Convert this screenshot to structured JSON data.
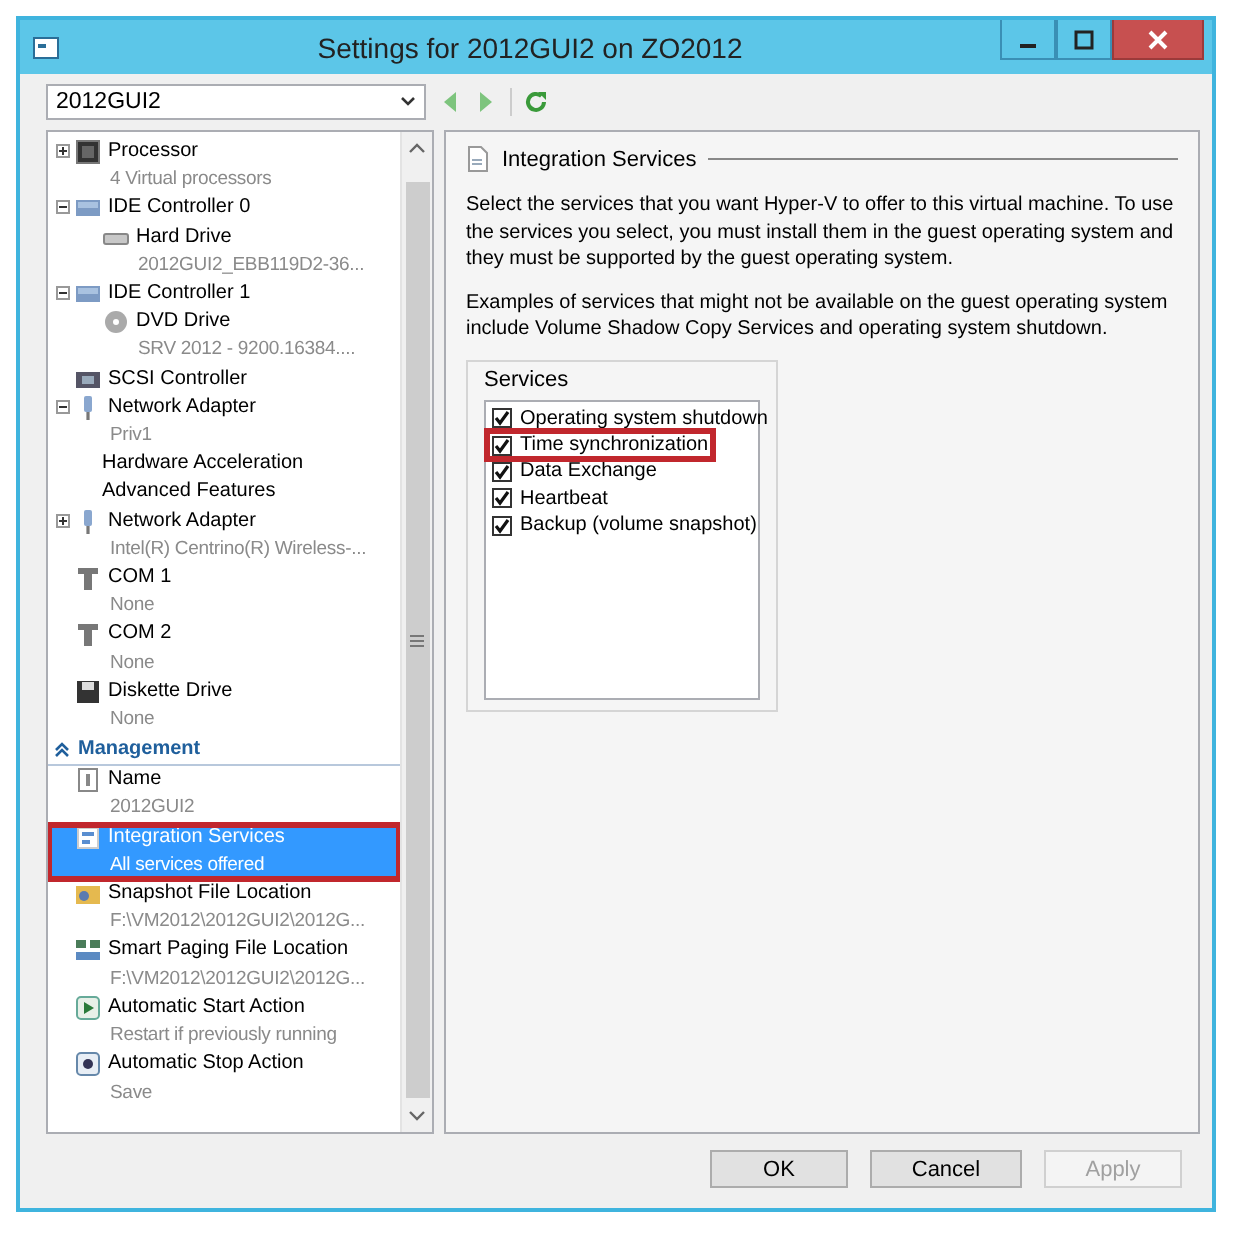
{
  "window": {
    "title": "Settings for 2012GUI2 on ZO2012"
  },
  "vm_selector": {
    "value": "2012GUI2"
  },
  "sidebar": {
    "sections": [
      {
        "items": [
          {
            "kind": "processor",
            "name": "Processor",
            "detail": "4 Virtual processors",
            "expanded": false,
            "selected": false,
            "highlighted": false
          },
          {
            "kind": "controller",
            "name": "IDE Controller 0",
            "expanded": true,
            "selected": false,
            "highlighted": false,
            "children": [
              {
                "kind": "disk",
                "name": "Hard Drive",
                "detail": "2012GUI2_EBB119D2-36...",
                "selected": false,
                "highlighted": false
              }
            ]
          },
          {
            "kind": "controller",
            "name": "IDE Controller 1",
            "expanded": true,
            "selected": false,
            "highlighted": false,
            "children": [
              {
                "kind": "dvd",
                "name": "DVD Drive",
                "detail": "SRV 2012 - 9200.16384....",
                "selected": false,
                "highlighted": false
              }
            ]
          },
          {
            "kind": "scsi",
            "name": "SCSI Controller",
            "selected": false,
            "highlighted": false
          },
          {
            "kind": "network",
            "name": "Network Adapter",
            "detail": "Priv1",
            "expanded": true,
            "selected": false,
            "highlighted": false,
            "children": [
              {
                "kind": "setting",
                "name": "Hardware Acceleration",
                "selected": false,
                "highlighted": false
              },
              {
                "kind": "setting",
                "name": "Advanced Features",
                "selected": false,
                "highlighted": false
              }
            ]
          },
          {
            "kind": "network",
            "name": "Network Adapter",
            "detail": "Intel(R) Centrino(R) Wireless-...",
            "expanded": false,
            "selected": false,
            "highlighted": false
          },
          {
            "kind": "com",
            "name": "COM 1",
            "detail": "None",
            "selected": false,
            "highlighted": false
          },
          {
            "kind": "com",
            "name": "COM 2",
            "detail": "None",
            "selected": false,
            "highlighted": false
          },
          {
            "kind": "floppy",
            "name": "Diskette Drive",
            "detail": "None",
            "selected": false,
            "highlighted": false
          }
        ]
      },
      {
        "title": "Management",
        "expanded": true,
        "items": [
          {
            "kind": "name",
            "name": "Name",
            "detail": "2012GUI2",
            "selected": false,
            "highlighted": false
          },
          {
            "kind": "integration",
            "name": "Integration Services",
            "detail": "All services offered",
            "selected": true,
            "highlighted": true
          },
          {
            "kind": "snapshot",
            "name": "Snapshot File Location",
            "detail": "F:\\VM2012\\2012GUI2\\2012G...",
            "selected": false,
            "highlighted": false
          },
          {
            "kind": "paging",
            "name": "Smart Paging File Location",
            "detail": "F:\\VM2012\\2012GUI2\\2012G...",
            "selected": false,
            "highlighted": false
          },
          {
            "kind": "start",
            "name": "Automatic Start Action",
            "detail": "Restart if previously running",
            "selected": false,
            "highlighted": false
          },
          {
            "kind": "stop",
            "name": "Automatic Stop Action",
            "detail": "Save",
            "selected": false,
            "highlighted": false
          }
        ]
      }
    ]
  },
  "panel": {
    "title": "Integration Services",
    "paragraphs": [
      "Select the services that you want Hyper-V to offer to this virtual machine. To use the services you select, you must install them in the guest operating system and they must be supported by the guest operating system.",
      "Examples of services that might not be available on the guest operating system include Volume Shadow Copy Services and operating system shutdown."
    ],
    "services": {
      "label": "Services",
      "items": [
        {
          "label": "Operating system shutdown",
          "checked": true,
          "highlighted": false
        },
        {
          "label": "Time synchronization",
          "checked": true,
          "highlighted": true
        },
        {
          "label": "Data Exchange",
          "checked": true,
          "highlighted": false
        },
        {
          "label": "Heartbeat",
          "checked": true,
          "highlighted": false
        },
        {
          "label": "Backup (volume snapshot)",
          "checked": true,
          "highlighted": false
        }
      ]
    }
  },
  "buttons": [
    {
      "label": "OK",
      "disabled": false
    },
    {
      "label": "Cancel",
      "disabled": false
    },
    {
      "label": "Apply",
      "disabled": true
    }
  ]
}
